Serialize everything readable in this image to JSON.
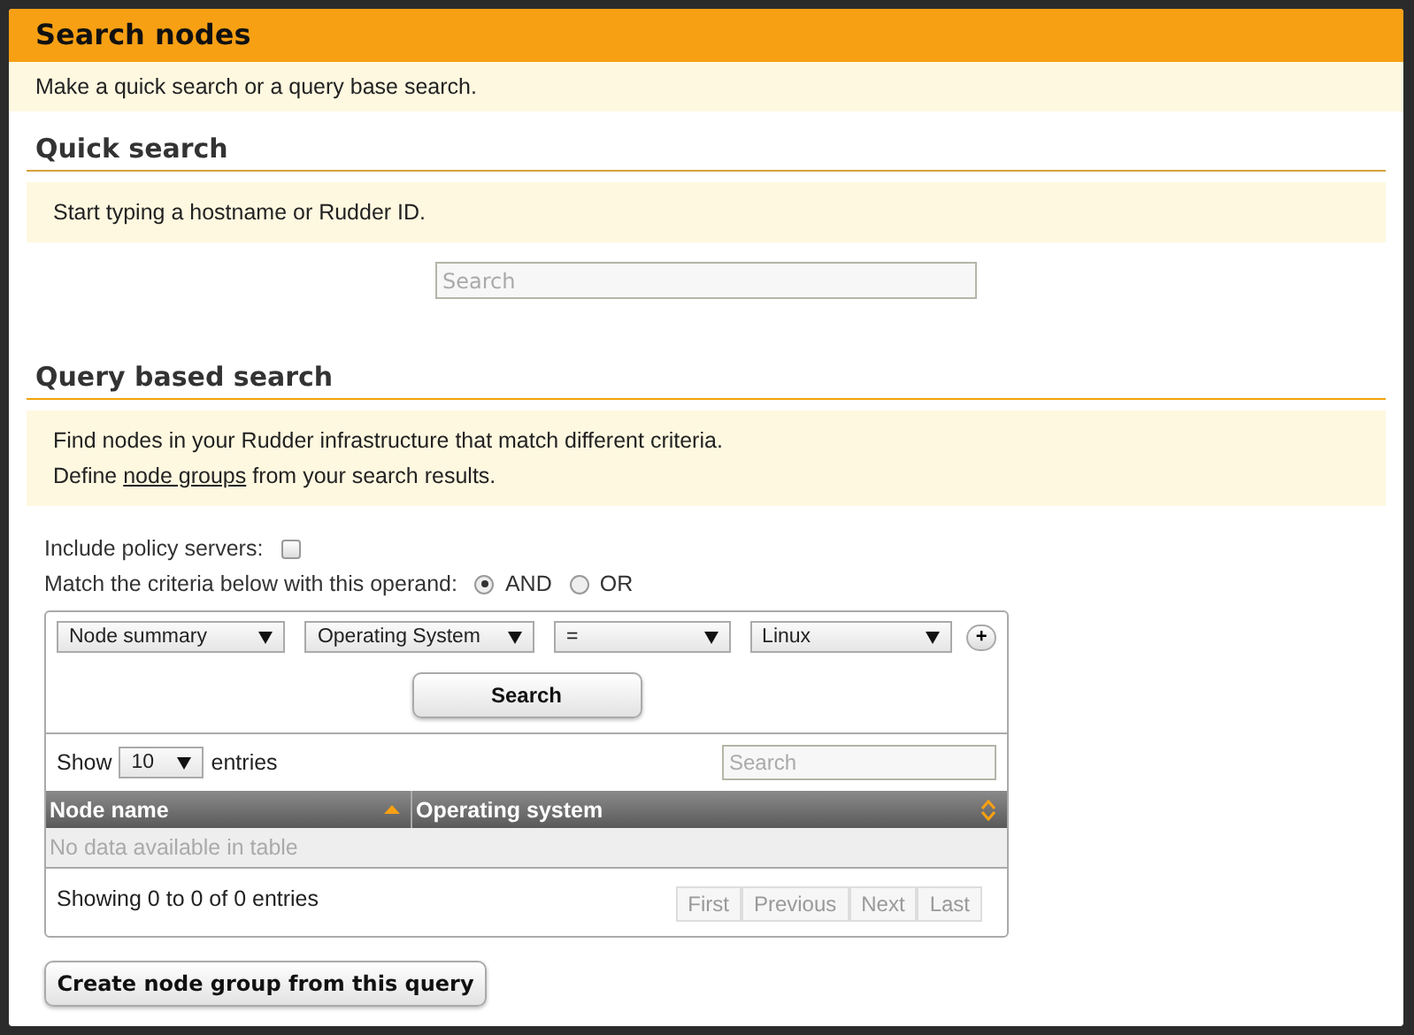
{
  "header": {
    "title": "Search nodes",
    "intro": "Make a quick search or a query base search."
  },
  "quick_search": {
    "heading": "Quick search",
    "note": "Start typing a hostname or Rudder ID.",
    "field": {
      "placeholder": "Search"
    }
  },
  "query_search": {
    "heading": "Query based search",
    "note_lines": [
      "Find nodes in your Rudder infrastructure that match different criteria.",
      [
        {
          "text": "Define "
        },
        {
          "link": "node groups"
        },
        {
          "text": " from your search results."
        }
      ]
    ],
    "include_policy_servers": {
      "label": "Include policy servers:",
      "checked": false
    },
    "operand": {
      "label": "Match the criteria below with this operand:",
      "options": [
        {
          "label": "AND",
          "selected": true
        },
        {
          "label": "OR",
          "selected": false
        }
      ]
    },
    "criteria": [
      {
        "object": "Node summary",
        "attribute": "Operating System",
        "comparator": "=",
        "value": "Linux",
        "add": "+"
      }
    ],
    "search_button": "Search"
  },
  "table": {
    "length": {
      "before": "Show",
      "value": "10",
      "after": "entries"
    },
    "filter": {
      "placeholder": "Search"
    },
    "columns": [
      {
        "label": "Node name",
        "sorted": true
      },
      {
        "label": "Operating system",
        "sorted": false
      }
    ],
    "empty": "No data available in table",
    "info": "Showing 0 to 0 of 0 entries",
    "pagination": [
      {
        "label": "First",
        "disabled": true
      },
      {
        "label": "Previous",
        "disabled": true
      },
      {
        "label": "Next",
        "disabled": true
      },
      {
        "label": "Last",
        "disabled": true
      }
    ]
  },
  "create_button": "Create node group from this query"
}
